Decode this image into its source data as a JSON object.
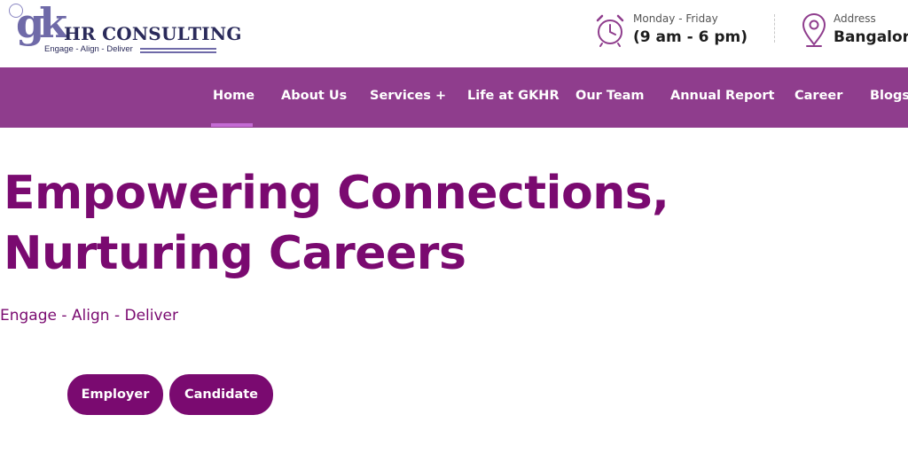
{
  "brand": {
    "logo_mark": "gk",
    "name": "HR CONSULTING",
    "tagline": "Engage - Align - Deliver"
  },
  "header_info": {
    "hours": {
      "icon": "alarm-clock-icon",
      "label": "Monday - Friday",
      "value": "(9 am - 6 pm)"
    },
    "address": {
      "icon": "location-pin-icon",
      "label": "Address",
      "value": "Bangalore"
    }
  },
  "nav": {
    "items": [
      {
        "label": "Home",
        "active": true
      },
      {
        "label": "About Us"
      },
      {
        "label": "Services +"
      },
      {
        "label": "Life at GKHR"
      },
      {
        "label": "Our Team"
      },
      {
        "label": "Annual Report"
      },
      {
        "label": "Career"
      },
      {
        "label": "Blogs"
      }
    ]
  },
  "hero": {
    "title_line1": "Empowering Connections,",
    "title_line2": "Nurturing Careers",
    "subtitle": "Engage - Align - Deliver",
    "buttons": {
      "employer": "Employer",
      "candidate": "Candidate"
    }
  },
  "colors": {
    "nav_bg": "#8f3d8d",
    "brand_purple": "#7a0a70",
    "icon_purple": "#8f3d8d",
    "active_underline": "#c46bd4"
  }
}
